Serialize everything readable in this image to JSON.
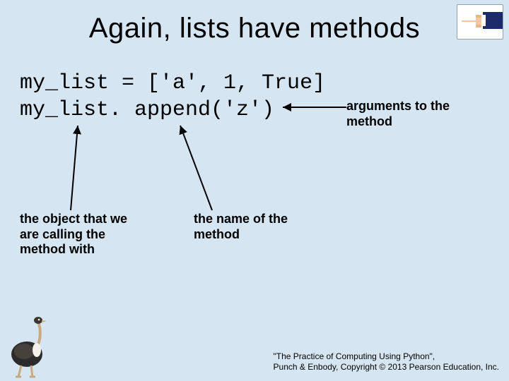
{
  "title": "Again, lists have methods",
  "code": {
    "line1": "my_list = ['a', 1, True]",
    "line2": "my_list. append('z')"
  },
  "annotations": {
    "arguments": "arguments to the method",
    "object": "the object that we are calling the method with",
    "method_name": "the name of the method"
  },
  "footer": {
    "line1": "\"The Practice of Computing Using Python\",",
    "line2": "Punch & Enbody, Copyright © 2013 Pearson Education, Inc."
  },
  "icons": {
    "pointer": "pointing-hand-icon",
    "ostrich": "ostrich-icon"
  },
  "colors": {
    "background": "#d5e6f2",
    "text": "#000000",
    "hand_sleeve": "#1a2a6b",
    "hand_skin": "#f2c9a4"
  }
}
